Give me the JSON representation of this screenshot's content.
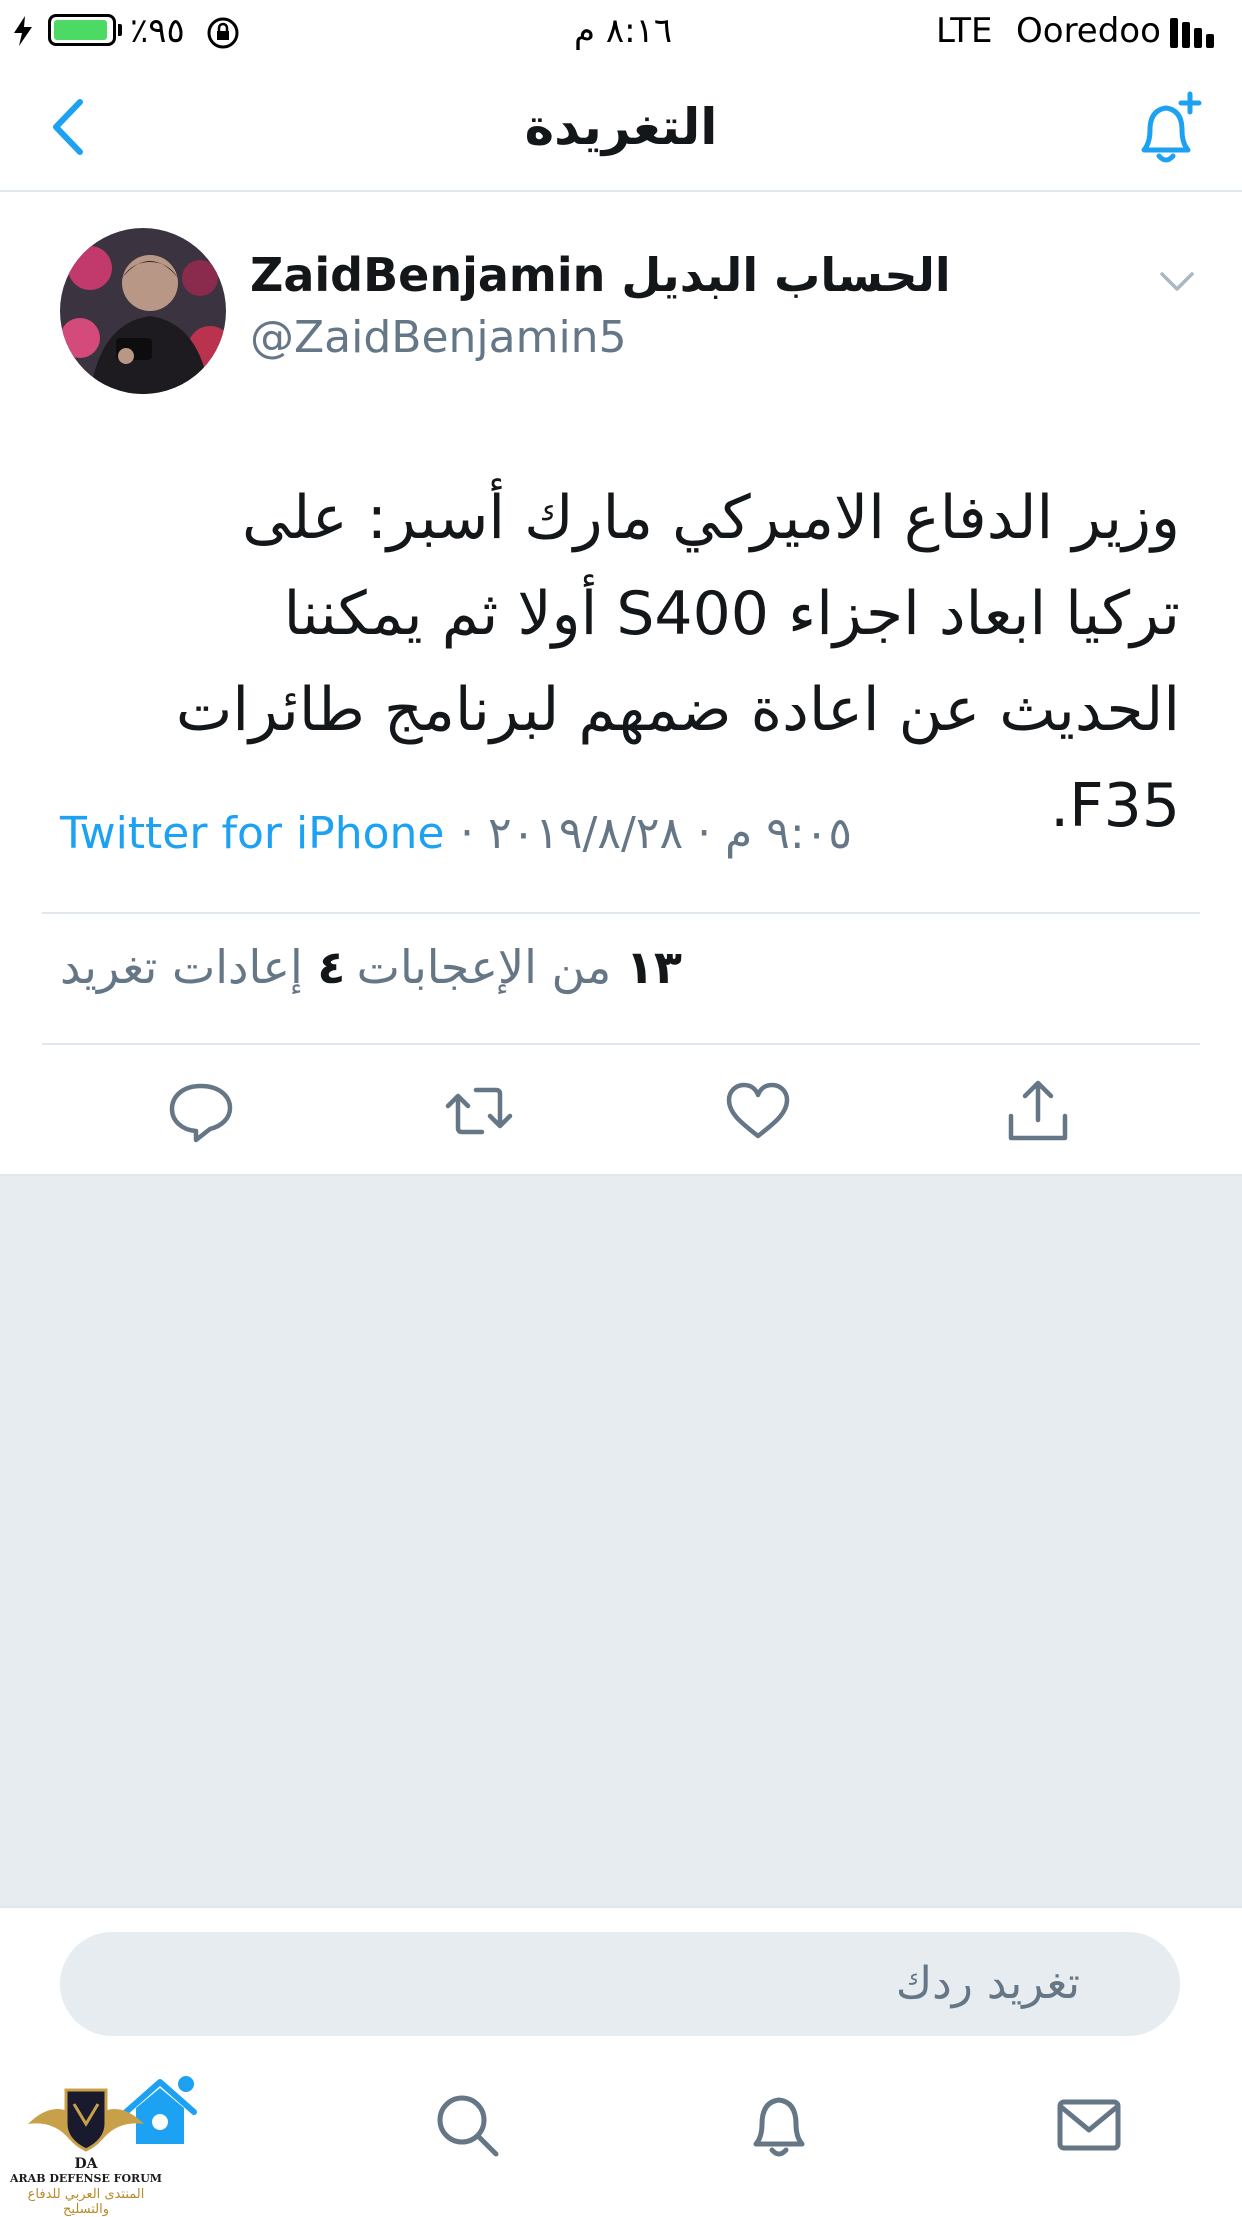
{
  "status_bar": {
    "carrier": "Ooredoo",
    "network": "LTE",
    "time": "٨:١٦ م",
    "battery_percent": "٪٩٥",
    "battery_level": 0.95
  },
  "nav": {
    "title": "التغريدة"
  },
  "tweet": {
    "display_name": "ZaidBenjamin الحساب البديل",
    "handle": "@ZaidBenjamin5",
    "text": "وزير الدفاع الاميركي مارك أسبر: على تركيا ابعاد اجزاء S400 أولا ثم يمكننا الحديث عن اعادة ضمهم لبرنامج طائرات F35.",
    "timestamp": "٩:٠٥ م · ٢٠١٩/٨/٢٨ ·",
    "source": "Twitter for iPhone",
    "likes_count": "١٣",
    "likes_label": "من الإعجابات",
    "retweets_count": "٤",
    "retweets_label": "إعادات تغريد"
  },
  "reply": {
    "placeholder": "تغريد ردك"
  },
  "watermark": {
    "line1": "ARAB DEFENSE FORUM",
    "line2": "المنتدى العربي للدفاع والتسليح",
    "monogram": "DA"
  },
  "colors": {
    "accent": "#1da1f2",
    "secondary_text": "#657786",
    "background_gray": "#e6ecf0",
    "battery": "#4cd964"
  },
  "icons": {
    "back": "chevron-left-icon",
    "notify": "bell-plus-icon",
    "caret": "chevron-down-icon",
    "reply": "reply-icon",
    "retweet": "retweet-icon",
    "like": "heart-icon",
    "share": "share-icon",
    "tab_home": "home-icon",
    "tab_search": "search-icon",
    "tab_notifications": "bell-icon",
    "tab_messages": "mail-icon"
  }
}
